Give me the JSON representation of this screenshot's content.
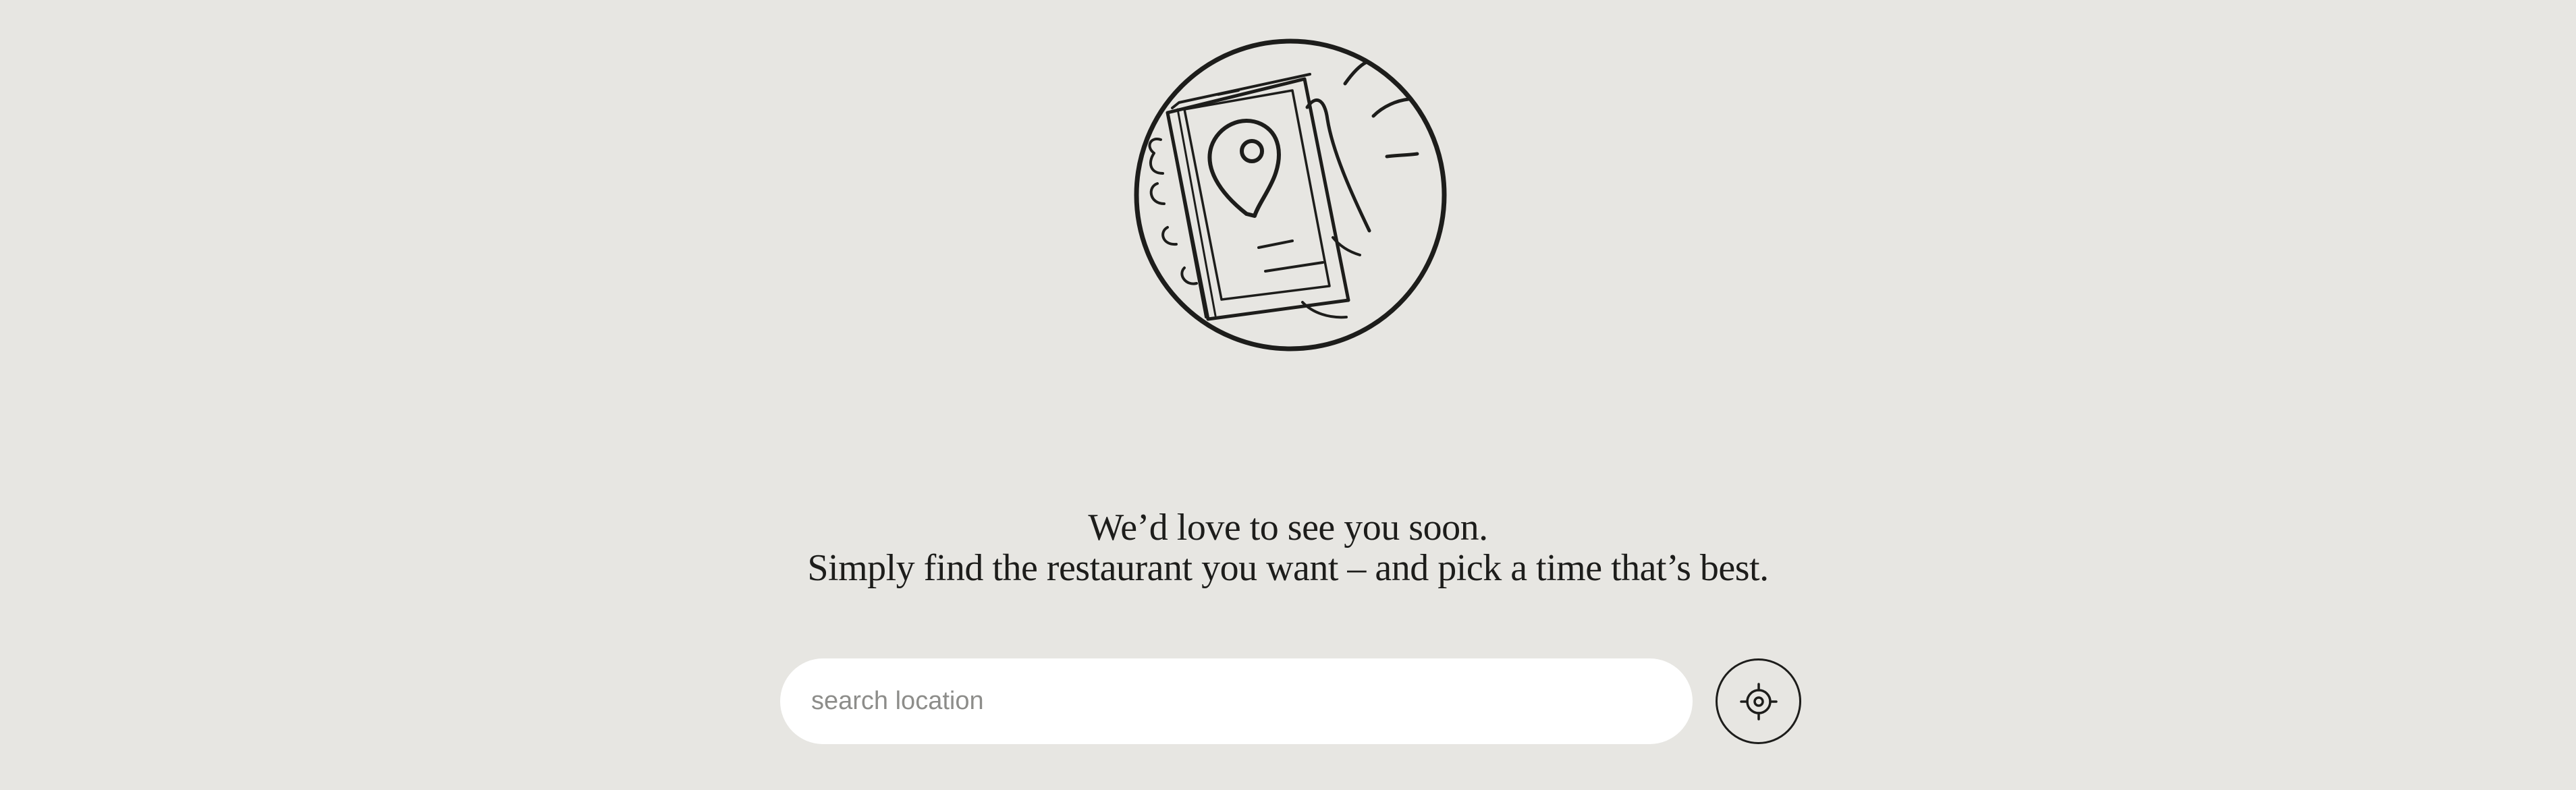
{
  "hero": {
    "illustration_icon": "hand-holding-phone-with-map-pin-icon"
  },
  "message": {
    "line1": "We’d love to see you soon.",
    "line2": "Simply find the restaurant you want – and pick a time that’s best."
  },
  "search": {
    "value": "",
    "placeholder": "search location"
  },
  "locate": {
    "icon": "crosshair-target-icon"
  },
  "colors": {
    "background": "#e7e6e2",
    "ink": "#1d1d1b",
    "input_background": "#ffffff",
    "placeholder": "#8d8d8a"
  }
}
